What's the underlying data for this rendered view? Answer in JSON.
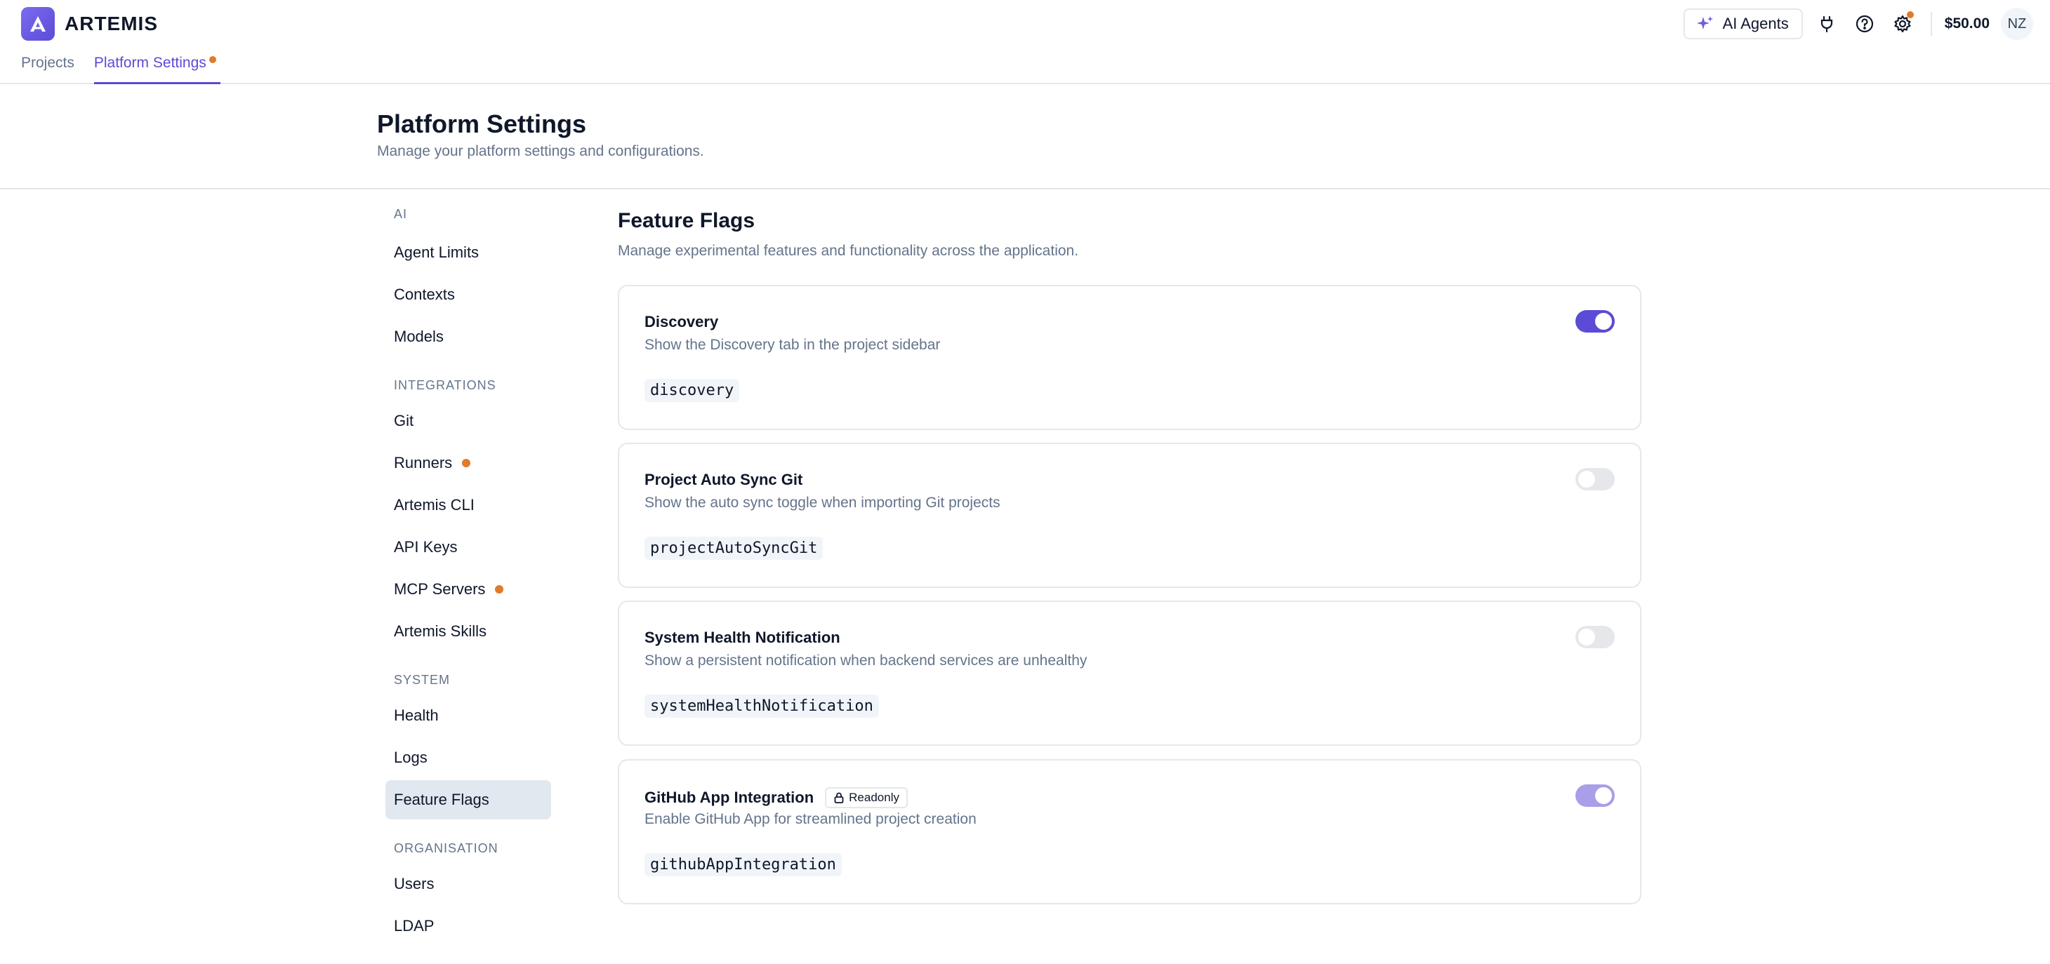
{
  "app": {
    "name": "ARTEMIS"
  },
  "nav": {
    "tabs": [
      {
        "label": "Projects"
      },
      {
        "label": "Platform Settings"
      }
    ]
  },
  "header": {
    "ai_agents_label": "AI Agents",
    "balance": "$50.00",
    "avatar_initials": "NZ"
  },
  "page": {
    "title": "Platform Settings",
    "subtitle": "Manage your platform settings and configurations."
  },
  "sidebar": {
    "sections": [
      {
        "title": "AI",
        "items": [
          "Agent Limits",
          "Contexts",
          "Models"
        ]
      },
      {
        "title": "INTEGRATIONS",
        "items": [
          "Git",
          "Runners",
          "Artemis CLI",
          "API Keys",
          "MCP Servers",
          "Artemis Skills"
        ]
      },
      {
        "title": "SYSTEM",
        "items": [
          "Health",
          "Logs",
          "Feature Flags"
        ]
      },
      {
        "title": "ORGANISATION",
        "items": [
          "Users",
          "LDAP"
        ]
      }
    ],
    "active_item": "Feature Flags"
  },
  "main": {
    "title": "Feature Flags",
    "subtitle": "Manage experimental features and functionality across the application.",
    "flags": [
      {
        "name": "Discovery",
        "description": "Show the Discovery tab in the project sidebar",
        "key": "discovery",
        "enabled": true,
        "readonly": false
      },
      {
        "name": "Project Auto Sync Git",
        "description": "Show the auto sync toggle when importing Git projects",
        "key": "projectAutoSyncGit",
        "enabled": false,
        "readonly": false
      },
      {
        "name": "System Health Notification",
        "description": "Show a persistent notification when backend services are unhealthy",
        "key": "systemHealthNotification",
        "enabled": false,
        "readonly": false
      },
      {
        "name": "GitHub App Integration",
        "description": "Enable GitHub App for streamlined project creation",
        "key": "githubAppIntegration",
        "enabled": true,
        "readonly": true,
        "badge": "Readonly"
      }
    ]
  },
  "colors": {
    "accent": "#5b4bd6",
    "notification_dot": "#e07b2a",
    "muted_text": "#64748b",
    "border": "#e5e7eb"
  }
}
